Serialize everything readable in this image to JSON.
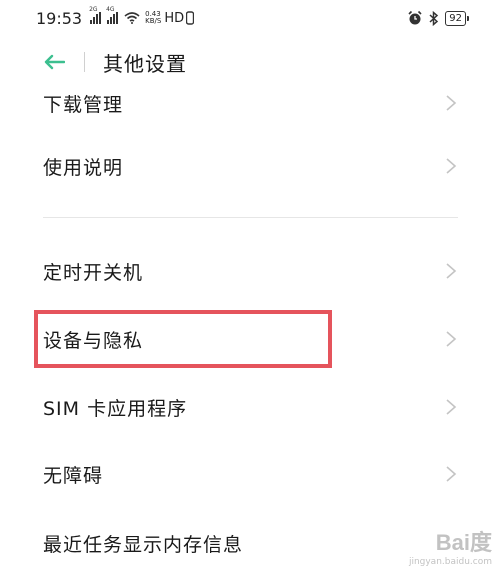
{
  "status_bar": {
    "time": "19:53",
    "sim1_tag": "2G",
    "sim2_tag": "4G",
    "speed_value": "0.43",
    "speed_unit": "KB/S",
    "network": "HD",
    "battery": "92"
  },
  "header": {
    "title": "其他设置"
  },
  "items": [
    {
      "label": "下载管理"
    },
    {
      "label": "使用说明"
    },
    {
      "label": "定时开关机"
    },
    {
      "label": "设备与隐私"
    },
    {
      "label": "SIM 卡应用程序"
    },
    {
      "label": "无障碍"
    },
    {
      "label": "最近任务显示内存信息"
    }
  ],
  "watermark": {
    "brand": "Bai度",
    "sub": "jingyan.baidu.com"
  },
  "colors": {
    "accent": "#3cbf8f",
    "highlight": "#e5545c"
  }
}
